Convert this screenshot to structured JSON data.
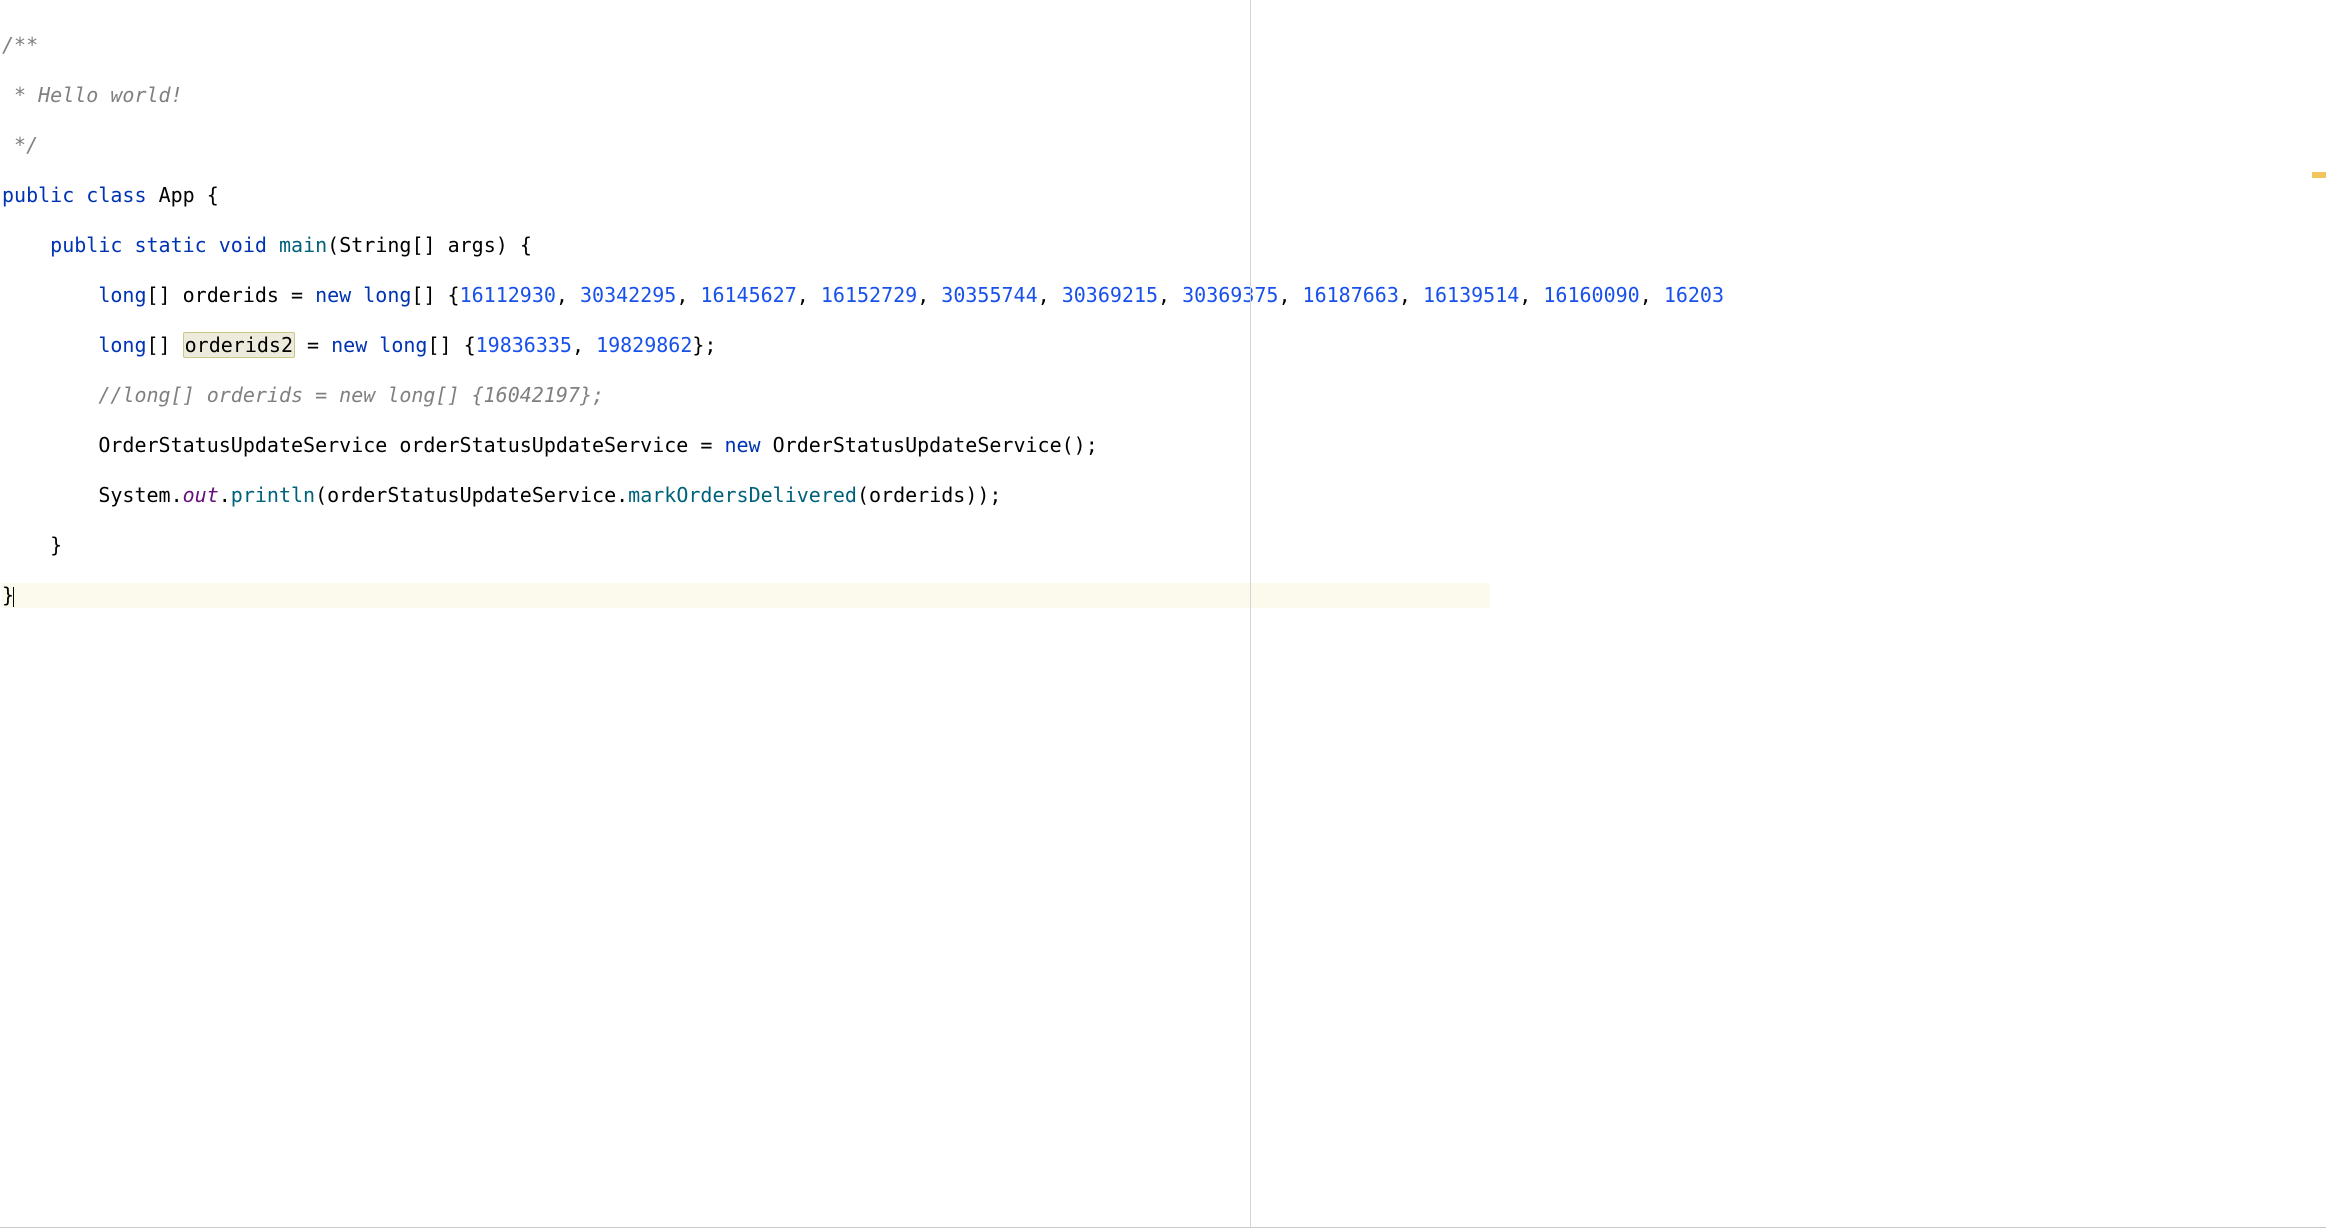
{
  "code": {
    "line1": "/**",
    "line2": " * Hello world!",
    "line3": " */",
    "line4": {
      "t1": "public",
      "t2": "class",
      "t3": "App",
      "t4": " {"
    },
    "line5": {
      "indent": "    ",
      "t1": "public",
      "t2": "static",
      "t3": "void",
      "t4": "main",
      "t5": "String",
      "t6": "[] args) {"
    },
    "line6": {
      "indent": "        ",
      "t1": "long",
      "t2": "[] orderids = ",
      "t3": "new",
      "t4": "long",
      "t5": "[] {",
      "n1": "16112930",
      "n2": "30342295",
      "n3": "16145627",
      "n4": "16152729",
      "n5": "30355744",
      "n6": "30369215",
      "n7": "30369375",
      "n8": "16187663",
      "n9": "16139514",
      "n10": "16160090",
      "n11": "16203",
      "sep": ", "
    },
    "line7": {
      "indent": "        ",
      "t1": "long",
      "t2": "[] ",
      "hl": "orderids2",
      "t3": " = ",
      "t4": "new",
      "t5": "long",
      "t6": "[] {",
      "n1": "19836335",
      "n2": "19829862",
      "t7": "};",
      "sep": ", "
    },
    "line8": {
      "indent": "        ",
      "comment": "//long[] orderids = new long[] {16042197};"
    },
    "line9": {
      "indent": "        ",
      "t1": "OrderStatusUpdateService",
      "t2": " orderStatusUpdateService = ",
      "t3": "new",
      "t4": " ",
      "t5": "OrderStatusUpdateService",
      "t6": "();"
    },
    "line10": {
      "indent": "        ",
      "t1": "System",
      "t2": ".",
      "t3": "out",
      "t4": ".",
      "t5": "println",
      "t6": "(orderStatusUpdateService.",
      "t7": "markOrdersDelivered",
      "t8": "(orderids));"
    },
    "line11": "    }",
    "line12": "}"
  }
}
